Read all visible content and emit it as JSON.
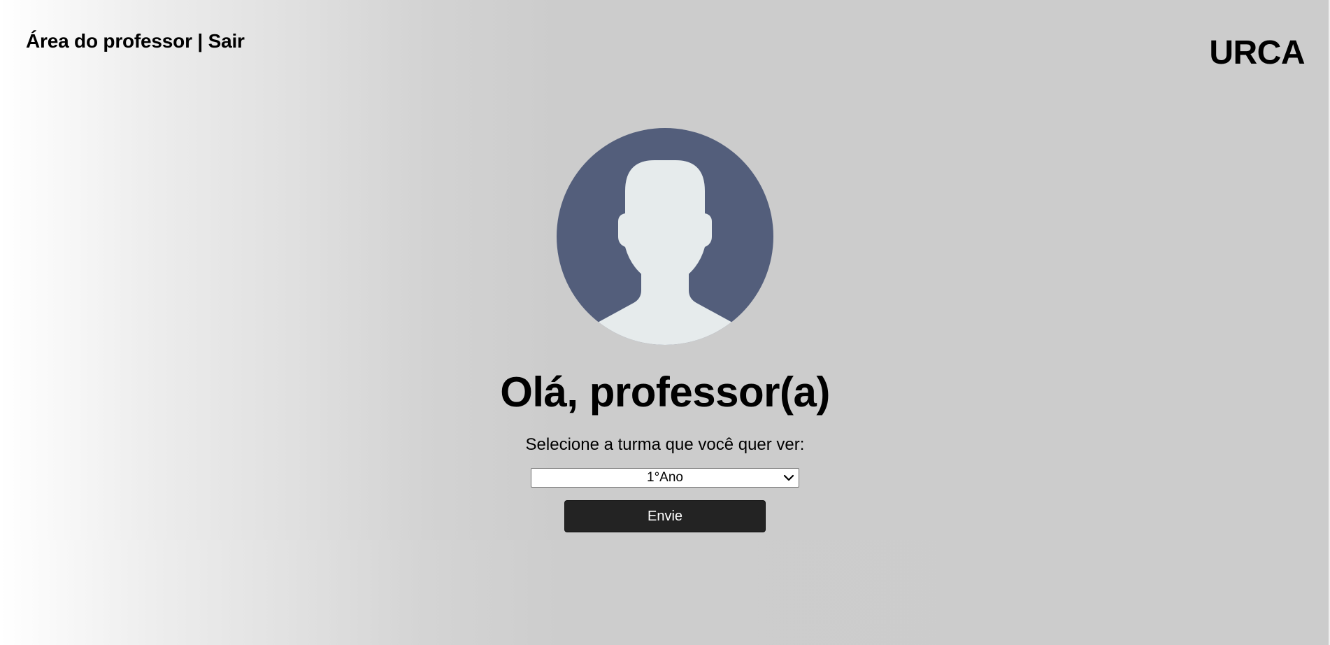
{
  "header": {
    "area_label": "Área do professor",
    "separator": "|",
    "logout_label": "Sair",
    "brand": "URCA"
  },
  "main": {
    "avatar_icon": "user-silhouette-icon",
    "greeting": "Olá, professor(a)",
    "prompt": "Selecione a turma que você quer ver:",
    "class_select": {
      "selected": "1°Ano"
    },
    "submit_label": "Envie"
  },
  "colors": {
    "avatar_bg": "#535e7b",
    "avatar_figure": "#e6ebec",
    "button_bg": "#232323",
    "page_bg": "#cccccc"
  }
}
